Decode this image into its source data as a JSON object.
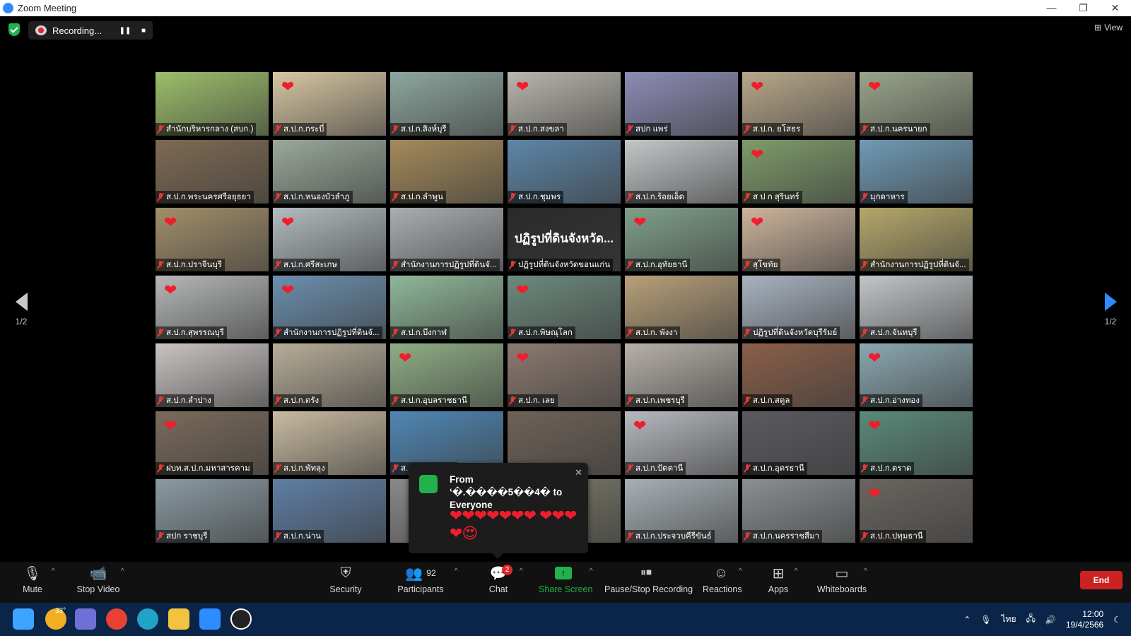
{
  "window": {
    "title": "Zoom Meeting",
    "minimize": "—",
    "maximize": "❐",
    "close": "✕"
  },
  "topbar": {
    "recording_label": "Recording...",
    "pause": "❚❚",
    "stop": "■",
    "view_label": "View",
    "view_icon": "⊞"
  },
  "nav": {
    "page": "1/2"
  },
  "tiles": [
    {
      "name": "สำนักบริหารกลาง (สบก.)",
      "bg": "#9cbf6a",
      "heart": false,
      "active": true
    },
    {
      "name": "ส.ป.ก.กระบี่",
      "bg": "#d7c7a2",
      "heart": true
    },
    {
      "name": "ส.ป.ก.สิงห์บุรี",
      "bg": "#8ea7a0",
      "heart": false
    },
    {
      "name": "ส.ป.ก.สงขลา",
      "bg": "#b9b6ad",
      "heart": true
    },
    {
      "name": "สปก แพร่",
      "bg": "#8d8cb6",
      "heart": false
    },
    {
      "name": "ส.ป.ก. ยโสธร",
      "bg": "#b8a88a",
      "heart": true
    },
    {
      "name": "ส.ป.ก.นครนายก",
      "bg": "#9aa58a",
      "heart": true
    },
    {
      "name": "ส.ป.ก.พระนครศรีอยุธยา",
      "bg": "#7e6a52",
      "heart": false
    },
    {
      "name": "ส.ป.ก.หนองบัวลำภู",
      "bg": "#9aa89a",
      "heart": false
    },
    {
      "name": "ส.ป.ก.ลำพูน",
      "bg": "#a58a5a",
      "heart": false
    },
    {
      "name": "ส.ป.ก.ชุมพร",
      "bg": "#5d86a8",
      "heart": false
    },
    {
      "name": "ส.ป.ก.ร้อยเอ็ด",
      "bg": "#c2c7c8",
      "heart": false
    },
    {
      "name": "ส ป ก สุรินทร์",
      "bg": "#7e9c6a",
      "heart": true
    },
    {
      "name": "มุกดาหาร",
      "bg": "#6f9ab5",
      "heart": false
    },
    {
      "name": "ส.ป.ก.ปราจีนบุรี",
      "bg": "#a28e6a",
      "heart": true
    },
    {
      "name": "ส.ป.ก.ศรีสะเกษ",
      "bg": "#b3bcbf",
      "heart": true
    },
    {
      "name": "สำนักงานการปฏิรูปที่ดินจั...",
      "bg": "#a9aeb1",
      "heart": false
    },
    {
      "name": "ปฏิรูปที่ดินจังหวัดขอนแก่น",
      "bg": "#2a2a2a",
      "heart": false,
      "text": "ปฏิรูปที่ดินจังหวัด..."
    },
    {
      "name": "ส.ป.ก.อุทัยธานี",
      "bg": "#7fa08a",
      "heart": true
    },
    {
      "name": "สุโขทัย",
      "bg": "#cdb49c",
      "heart": true
    },
    {
      "name": "สำนักงานการปฏิรูปที่ดินจั...",
      "bg": "#b5a76a",
      "heart": false
    },
    {
      "name": "ส.ป.ก.สุพรรณบุรี",
      "bg": "#b5b7b8",
      "heart": true
    },
    {
      "name": "สำนักงานการปฏิรูปที่ดินจั...",
      "bg": "#6b8fae",
      "heart": true
    },
    {
      "name": "ส.ป.ก.บึงกาฬ",
      "bg": "#8fb89a",
      "heart": false
    },
    {
      "name": "ส.ป.ก.พิษณุโลก",
      "bg": "#6c8a7d",
      "heart": true
    },
    {
      "name": "ส.ป.ก. พังงา",
      "bg": "#b8a07a",
      "heart": false
    },
    {
      "name": "ปฏิรูปที่ดินจังหวัดบุรีรัมย์",
      "bg": "#a9b3c0",
      "heart": false
    },
    {
      "name": "ส.ป.ก.จันทบุรี",
      "bg": "#c2c6c9",
      "heart": false
    },
    {
      "name": "ส.ป.ก.ลำปาง",
      "bg": "#c9c4c2",
      "heart": false
    },
    {
      "name": "ส.ป.ก.ตรัง",
      "bg": "#b7ae98",
      "heart": false
    },
    {
      "name": "ส.ป.ก.อุบลราชธานี",
      "bg": "#8fae84",
      "heart": true
    },
    {
      "name": "ส.ป.ก. เลย",
      "bg": "#8c7a70",
      "heart": true
    },
    {
      "name": "ส.ป.ก.เพชรบุรี",
      "bg": "#b6b0a8",
      "heart": false
    },
    {
      "name": "ส.ป.ก.สตูล",
      "bg": "#8a5f48",
      "heart": false
    },
    {
      "name": "ส.ป.ก.อ่างทอง",
      "bg": "#8aa8b0",
      "heart": true
    },
    {
      "name": "ฝบท.ส.ป.ก.มหาสารคาม",
      "bg": "#7a6a5a",
      "heart": true
    },
    {
      "name": "ส.ป.ก.พัทลุง",
      "bg": "#c8bba0",
      "heart": false
    },
    {
      "name": "ส.ป.ก.เชียงใหม่",
      "bg": "#4e87b5",
      "heart": false
    },
    {
      "name": "",
      "bg": "#6e6258",
      "heart": false
    },
    {
      "name": "ส.ป.ก.ปัตตานี",
      "bg": "#b7b9bf",
      "heart": true
    },
    {
      "name": "ส.ป.ก.อุดรธานี",
      "bg": "#5c5a60",
      "heart": false
    },
    {
      "name": "ส.ป.ก.ตราด",
      "bg": "#5a8a7a",
      "heart": true
    },
    {
      "name": "สปก ราชบุรี",
      "bg": "#8a9aa2",
      "heart": false
    },
    {
      "name": "ส.ป.ก.น่าน",
      "bg": "#5f7fa5",
      "heart": false
    },
    {
      "name": "",
      "bg": "#8a8a8a",
      "heart": false
    },
    {
      "name": "",
      "bg": "#7a7a6a",
      "heart": false
    },
    {
      "name": "ส.ป.ก.ประจวบคีรีขันธ์",
      "bg": "#a8b0b5",
      "heart": false
    },
    {
      "name": "ส.ป.ก.นครราชสีมา",
      "bg": "#8a8f92",
      "heart": false
    },
    {
      "name": "ส.ป.ก.ปทุมธานี",
      "bg": "#6a6560",
      "heart": true
    }
  ],
  "chat_popup": {
    "from": "From ‘�.����5��4� to Everyone",
    "message": "❤❤❤❤❤❤❤ ❤❤❤❤😍",
    "close": "✕"
  },
  "toolbar": {
    "mute": "Mute",
    "stop_video": "Stop Video",
    "security": "Security",
    "participants": "Participants",
    "participants_count": "92",
    "chat": "Chat",
    "chat_badge": "2",
    "share_screen": "Share Screen",
    "pause_stop_recording": "Pause/Stop Recording",
    "reactions": "Reactions",
    "apps": "Apps",
    "whiteboards": "Whiteboards",
    "end": "End"
  },
  "taskbar": {
    "temperature": "33°",
    "language": "ไทย",
    "time": "12:00",
    "date": "19/4/2566"
  },
  "colors": {
    "accent": "#2d8cff",
    "recording": "#e02828",
    "share": "#23b14d",
    "end": "#cc2222",
    "heart": "#f01e2c"
  }
}
